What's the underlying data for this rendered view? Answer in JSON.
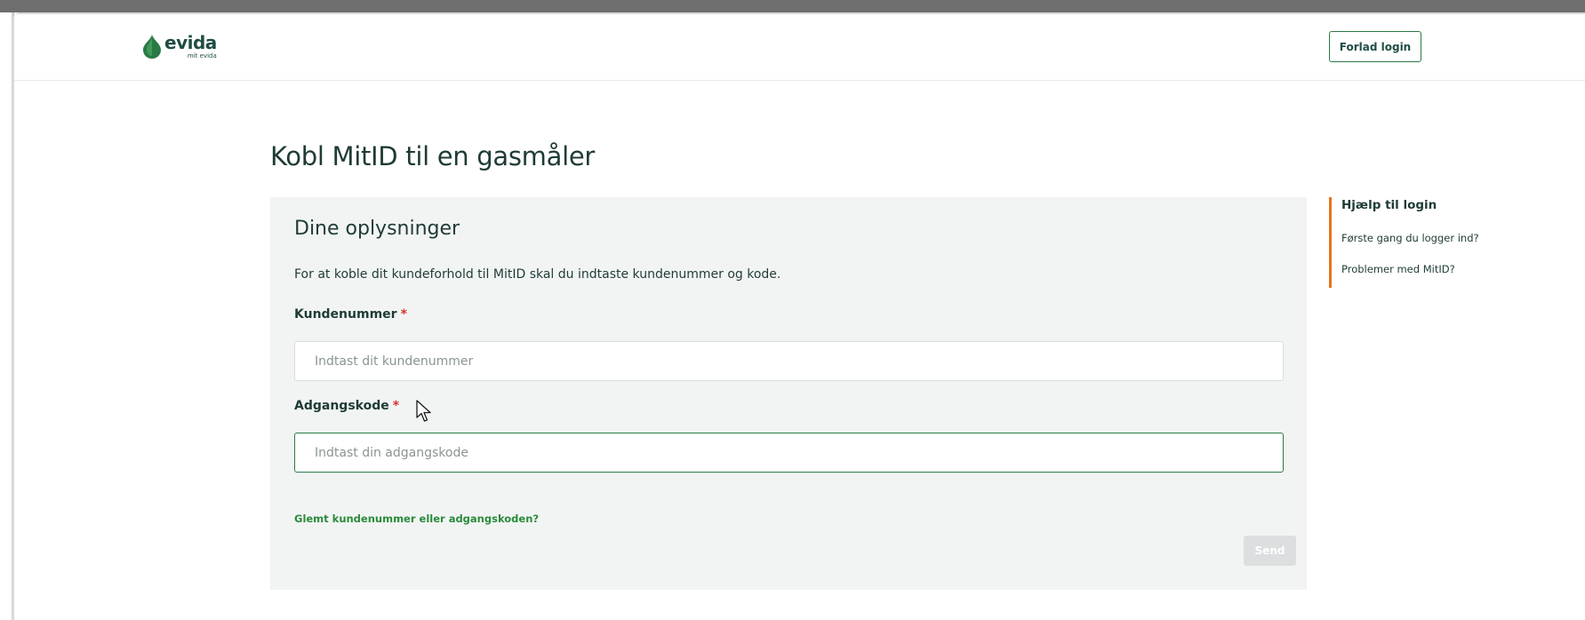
{
  "header": {
    "logo_word": "evida",
    "logo_sub": "mit evida",
    "leave_button": "Forlad login"
  },
  "page": {
    "title": "Kobl MitID til en gasmåler"
  },
  "form": {
    "heading": "Dine oplysninger",
    "intro": "For at koble dit kundeforhold til MitID skal du indtaste kundenummer og kode.",
    "customer_number": {
      "label": "Kundenummer",
      "required_mark": "*",
      "placeholder": "Indtast dit kundenummer",
      "value": ""
    },
    "password": {
      "label": "Adgangskode",
      "required_mark": "*",
      "placeholder": "Indtast din adgangskode",
      "value": ""
    },
    "forgot_link": "Glemt kundenummer eller adgangskoden?",
    "send_button": "Send"
  },
  "help": {
    "title": "Hjælp til login",
    "links": [
      "Første gang du logger ind?",
      "Problemer med MitID?"
    ]
  },
  "colors": {
    "brand_green": "#2a7a45",
    "link_green": "#2a8a3a",
    "accent_orange": "#e5731e",
    "required_red": "#d9302c",
    "panel_bg": "#f2f4f4",
    "text_dark": "#1f3b36",
    "disabled_button": "#dcdfdf"
  },
  "icons": {
    "logo": "evida-drop-logo-icon",
    "cursor": "mouse-pointer-icon"
  }
}
